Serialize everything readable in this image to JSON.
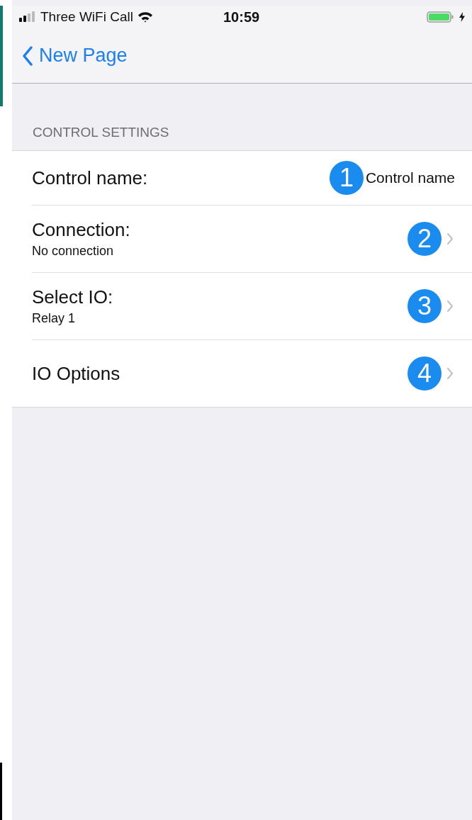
{
  "status_bar": {
    "carrier": "Three WiFi Call",
    "time": "10:59"
  },
  "nav": {
    "back_label": "New Page"
  },
  "section": {
    "header": "CONTROL SETTINGS",
    "rows": [
      {
        "kind": "value",
        "label": "Control name:",
        "value": "Control name",
        "marker": "1"
      },
      {
        "kind": "nav",
        "label": "Connection:",
        "detail": "No connection",
        "marker": "2"
      },
      {
        "kind": "nav",
        "label": "Select IO:",
        "detail": "Relay 1",
        "marker": "3"
      },
      {
        "kind": "nav",
        "label": "IO Options",
        "marker": "4"
      }
    ]
  }
}
